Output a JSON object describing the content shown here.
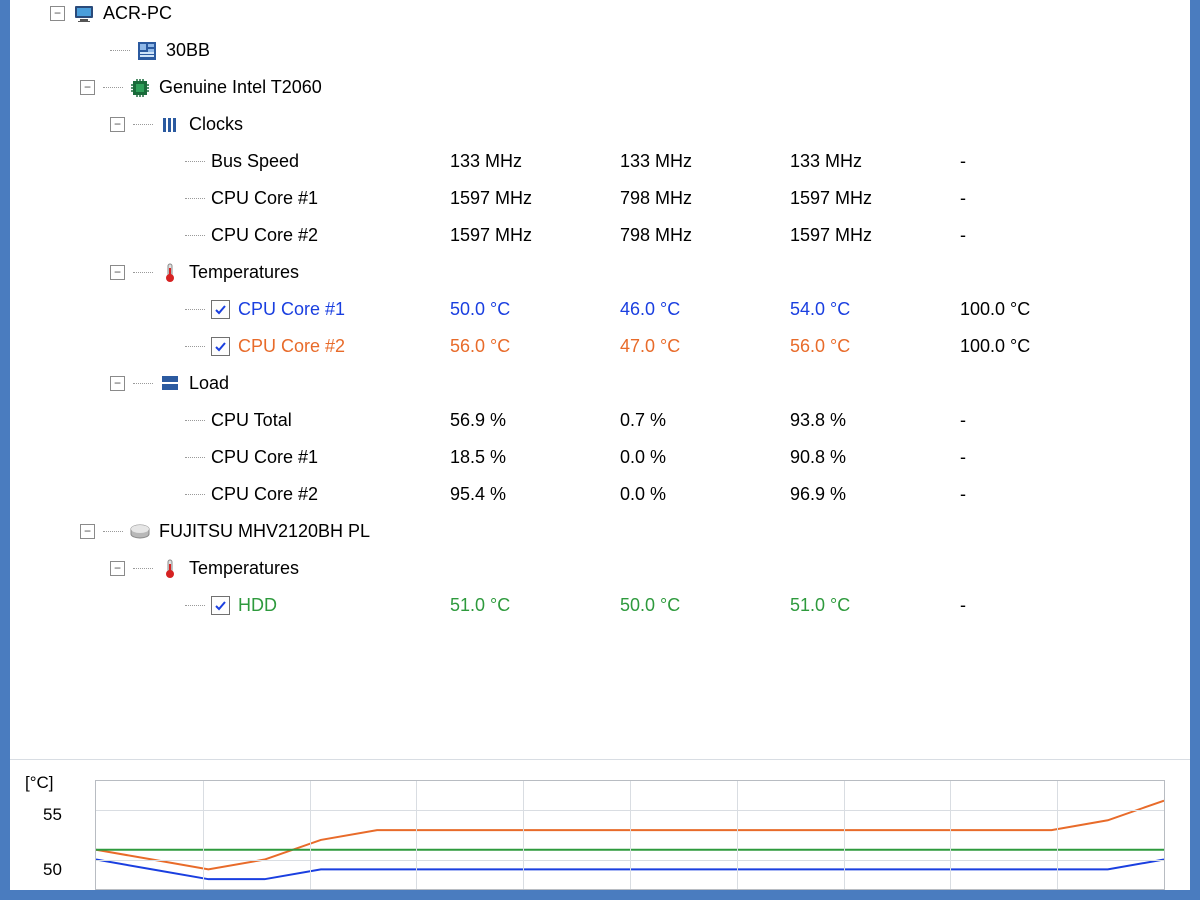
{
  "tree": {
    "pc": {
      "label": "ACR-PC"
    },
    "mobo": {
      "label": "30BB"
    },
    "cpu": {
      "label": "Genuine Intel T2060"
    },
    "clocks": {
      "label": "Clocks"
    },
    "bus": {
      "label": "Bus Speed",
      "cur": "133 MHz",
      "min": "133 MHz",
      "max": "133 MHz",
      "lim": "-"
    },
    "core1c": {
      "label": "CPU Core #1",
      "cur": "1597 MHz",
      "min": "798 MHz",
      "max": "1597 MHz",
      "lim": "-"
    },
    "core2c": {
      "label": "CPU Core #2",
      "cur": "1597 MHz",
      "min": "798 MHz",
      "max": "1597 MHz",
      "lim": "-"
    },
    "temps": {
      "label": "Temperatures"
    },
    "core1t": {
      "label": "CPU Core #1",
      "cur": "50.0 °C",
      "min": "46.0 °C",
      "max": "54.0 °C",
      "lim": "100.0 °C"
    },
    "core2t": {
      "label": "CPU Core #2",
      "cur": "56.0 °C",
      "min": "47.0 °C",
      "max": "56.0 °C",
      "lim": "100.0 °C"
    },
    "load": {
      "label": "Load"
    },
    "lt": {
      "label": "CPU Total",
      "cur": "56.9 %",
      "min": "0.7 %",
      "max": "93.8 %",
      "lim": "-"
    },
    "l1": {
      "label": "CPU Core #1",
      "cur": "18.5 %",
      "min": "0.0 %",
      "max": "90.8 %",
      "lim": "-"
    },
    "l2": {
      "label": "CPU Core #2",
      "cur": "95.4 %",
      "min": "0.0 %",
      "max": "96.9 %",
      "lim": "-"
    },
    "hdd": {
      "label": "FUJITSU MHV2120BH PL"
    },
    "hddtemps": {
      "label": "Temperatures"
    },
    "hddt": {
      "label": "HDD",
      "cur": "51.0 °C",
      "min": "50.0 °C",
      "max": "51.0 °C",
      "lim": "-"
    }
  },
  "chart": {
    "unit_label": "[°C]",
    "tick55": "55",
    "tick50": "50"
  },
  "chart_data": {
    "type": "line",
    "ylabel": "°C",
    "ylim": [
      47,
      58
    ],
    "xticks": 10,
    "series": [
      {
        "name": "CPU Core #1",
        "color": "#1a3fe0",
        "values": [
          50,
          49,
          48,
          48,
          49,
          49,
          49,
          49,
          49,
          49,
          49,
          49,
          49,
          49,
          49,
          49,
          49,
          49,
          49,
          50
        ]
      },
      {
        "name": "CPU Core #2",
        "color": "#e86b2a",
        "values": [
          51,
          50,
          49,
          50,
          52,
          53,
          53,
          53,
          53,
          53,
          53,
          53,
          53,
          53,
          53,
          53,
          53,
          53,
          54,
          56
        ]
      },
      {
        "name": "HDD",
        "color": "#2e9a3d",
        "values": [
          51,
          51,
          51,
          51,
          51,
          51,
          51,
          51,
          51,
          51,
          51,
          51,
          51,
          51,
          51,
          51,
          51,
          51,
          51,
          51
        ]
      }
    ]
  }
}
